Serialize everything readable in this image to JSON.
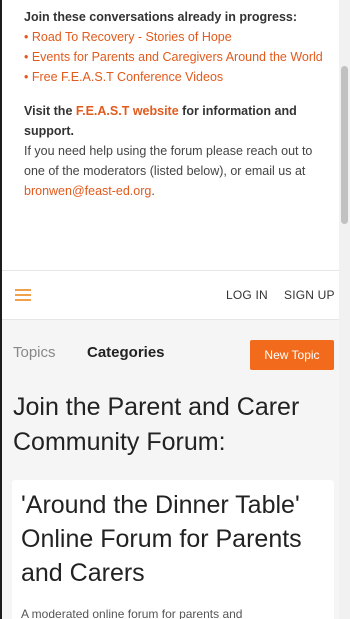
{
  "intro": {
    "heading": "Join these conversations already in progress:",
    "links": [
      "• Road To Recovery - Stories of Hope",
      "• Events for Parents and Caregivers Around the World",
      "• Free F.E.A.S.T Conference Videos"
    ],
    "visit_prefix": "Visit the ",
    "visit_link": "F.E.A.S.T website",
    "visit_suffix": " for information and support.",
    "help_text": "If you need help using the forum please reach out to one of the moderators (listed below), or email us at",
    "email": "bronwen@feast-ed.org",
    "email_suffix": "."
  },
  "header": {
    "login_label": "LOG IN",
    "signup_label": "SIGN UP"
  },
  "tabs": {
    "topics": "Topics",
    "categories": "Categories"
  },
  "new_topic_label": "New Topic",
  "page_title": "Join the Parent and Carer Community Forum:",
  "category": {
    "title": "'Around the Dinner Table' Online Forum for Parents and Carers",
    "description": "A moderated online forum for parents and"
  },
  "colors": {
    "accent": "#f26b1d",
    "link": "#e25a1c",
    "hamburger": "#f0a04b"
  }
}
